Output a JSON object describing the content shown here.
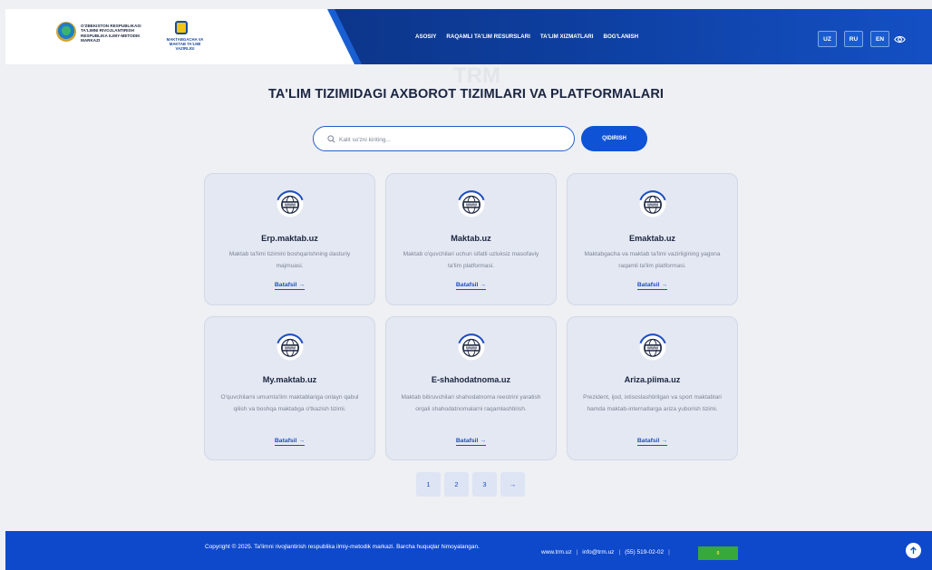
{
  "header": {
    "org_name": "O'ZBEKISTON RESPUBLIKASI TA'LIMNI RIVOJLANTIRISH RESPUBLIKA ILMIY-METODIK MARKAZI",
    "ministry_name": "MAKTABGACHA VA MAKTAB TA'LIMI VAZIRLIGI",
    "nav": [
      "ASOSIY",
      "RAQAMLI TA'LIM RESURSLARI",
      "TA'LIM XIZMATLARI",
      "BOG'LANISH"
    ],
    "languages": [
      "UZ",
      "RU",
      "EN"
    ],
    "colors": {
      "primary": "#0e52d6",
      "dark": "#0c2a6e"
    }
  },
  "main": {
    "watermark": "TRM",
    "title": "TA'LIM TIZIMIDAGI AXBOROT TIZIMLARI VA PLATFORMALARI",
    "search": {
      "placeholder": "Kalit so'zni kiriting...",
      "value": "",
      "button": "QIDIRISH"
    },
    "cards": [
      {
        "title": "Erp.maktab.uz",
        "description": "Maktab ta'limi tizimini boshqarishning dasturiy majmuasi.",
        "link": "Batafsil →"
      },
      {
        "title": "Maktab.uz",
        "description": "Maktab o'quvchilari uchun sifatli uzluksiz masofaviy ta'lim platformasi.",
        "link": "Batafsil →"
      },
      {
        "title": "Emaktab.uz",
        "description": "Maktabgacha va maktab ta'limi vazirligining yagona raqamli ta'lim platformasi.",
        "link": "Batafsil →"
      },
      {
        "title": "My.maktab.uz",
        "description": "O'quvchilarni umumta'lim maktablariga onlayn qabul qilish va boshqa maktabga o'tkazish tizimi.",
        "link": "Batafsil →"
      },
      {
        "title": "E-shahodatnoma.uz",
        "description": "Maktab bitiruvchilari shahodatnoma reestrini yaratish orqali shahodatnomalarni raqamlashtirish.",
        "link": "Batafsil →"
      },
      {
        "title": "Ariza.piima.uz",
        "description": "Prezident, ijod, ixtisoslashtirilgan va sport maktablari hamda maktab-internatlarga ariza yuborish tizimi.",
        "link": "Batafsil →"
      }
    ],
    "pagination": [
      "1",
      "2",
      "3",
      "→"
    ]
  },
  "footer": {
    "copyright": "Copyright © 2025. Ta'limni rivojlantirish respublika ilmiy-metodik markazi. Barcha huquqlar himoyalangan.",
    "website": "www.trm.uz",
    "email": "info@trm.uz",
    "phone": "(55) 519-02-02",
    "counter": "0"
  }
}
